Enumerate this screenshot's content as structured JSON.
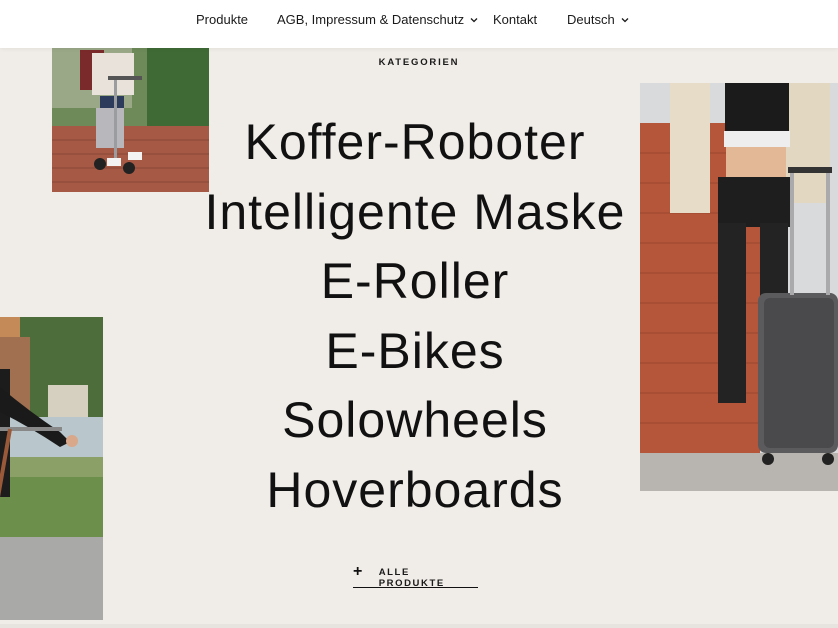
{
  "nav": {
    "items": [
      {
        "label": "Produkte"
      },
      {
        "label": "AGB, Impressum & Datenschutz"
      },
      {
        "label": "Kontakt"
      },
      {
        "label": "Deutsch"
      }
    ]
  },
  "section": {
    "eyebrow": "KATEGORIEN",
    "categories": [
      "Koffer-Roboter",
      "Intelligente Maske",
      "E-Roller",
      "E-Bikes",
      "Solowheels",
      "Hoverboards"
    ],
    "all_products_label": "ALLE PRODUKTE"
  },
  "colors": {
    "background": "#f0ece7",
    "text": "#111111",
    "nav_background": "#ffffff"
  },
  "icons": {
    "language_caret": "chevron-down-icon",
    "legal_caret": "chevron-down-icon",
    "all_products": "plus-icon"
  }
}
